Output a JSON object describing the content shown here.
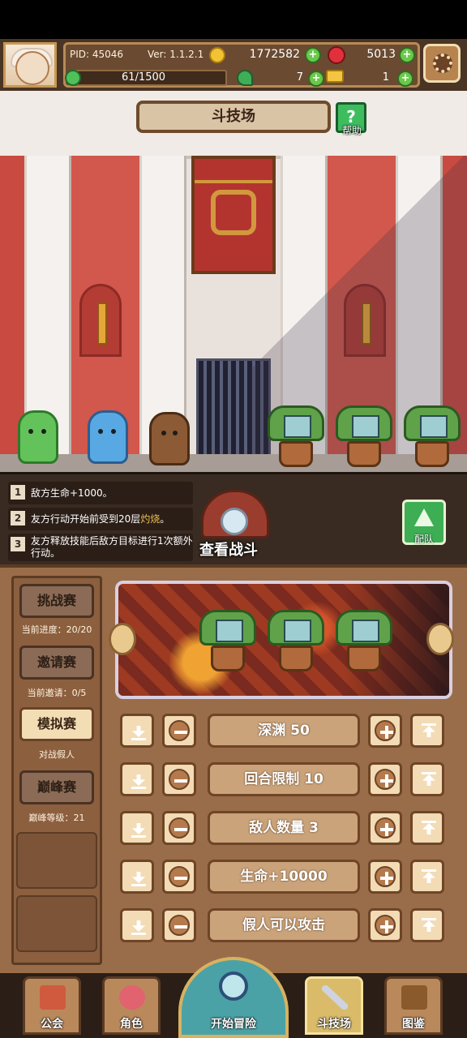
{
  "header": {
    "pid": "PID: 45046",
    "version": "Ver: 1.1.2.1",
    "gold": "1772582",
    "gems": "5013",
    "energy": "61/1500",
    "clovers": "7",
    "keys": "1",
    "icons": {
      "gold": "coin-icon",
      "gems": "red-gem-icon",
      "energy": "energy-icon",
      "clovers": "clover-icon",
      "keys": "key-icon",
      "settings": "gear-icon"
    }
  },
  "arena": {
    "title": "斗技场",
    "help_label": "帮助",
    "help_glyph": "?"
  },
  "buffs": [
    {
      "num": "1",
      "text": "敌方生命+1000。"
    },
    {
      "num": "2",
      "text_before": "友方行动开始前受到20层",
      "text_highlight": "灼烧",
      "text_after": "。"
    },
    {
      "num": "3",
      "text": "友方释放技能后敌方目标进行1次额外行动。"
    }
  ],
  "view_battle_label": "查看战斗",
  "team_label": "配队",
  "modes": [
    {
      "label": "挑战赛",
      "sub": "当前进度：20/20",
      "active": false
    },
    {
      "label": "邀请赛",
      "sub": "当前邀请：0/5",
      "active": false
    },
    {
      "label": "模拟赛",
      "sub": "对战假人",
      "active": true
    },
    {
      "label": "巅峰赛",
      "sub": "巅峰等级：21",
      "active": false
    }
  ],
  "settings_rows": [
    {
      "label": "深渊 50"
    },
    {
      "label": "回合限制 10"
    },
    {
      "label": "敌人数量 3"
    },
    {
      "label": "生命+10000"
    },
    {
      "label": "假人可以攻击"
    }
  ],
  "nav": {
    "guild": "公会",
    "character": "角色",
    "start": "开始冒险",
    "arena": "斗技场",
    "codex": "图鉴",
    "active": "arena"
  }
}
